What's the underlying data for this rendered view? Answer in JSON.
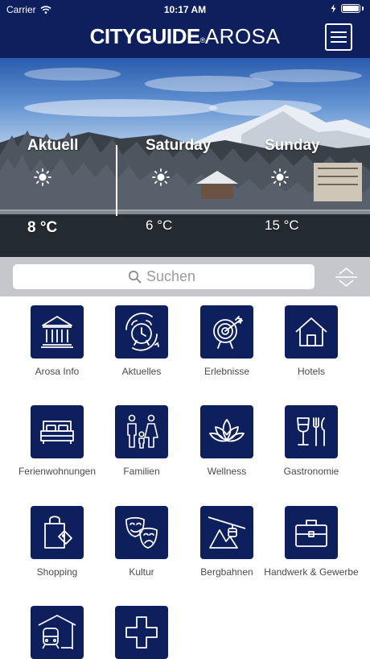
{
  "status_bar": {
    "carrier": "Carrier",
    "time": "10:17 AM"
  },
  "header": {
    "brand": "CITYGUIDE",
    "registered": "®",
    "town": "AROSA",
    "background_color": "#0d1f5c"
  },
  "weather": [
    {
      "label": "Aktuell",
      "temp": "8 °C",
      "icon": "sun-icon"
    },
    {
      "label": "Saturday",
      "temp": "6 °C",
      "icon": "sun-icon"
    },
    {
      "label": "Sunday",
      "temp": "15 °C",
      "icon": "sun-icon"
    }
  ],
  "search": {
    "placeholder": "Suchen"
  },
  "categories": [
    {
      "label": "Arosa Info",
      "icon": "museum-icon"
    },
    {
      "label": "Aktuelles",
      "icon": "alarm-clock-icon"
    },
    {
      "label": "Erlebnisse",
      "icon": "target-icon"
    },
    {
      "label": "Hotels",
      "icon": "house-icon"
    },
    {
      "label": "Ferienwohnungen",
      "icon": "bed-icon"
    },
    {
      "label": "Familien",
      "icon": "family-icon"
    },
    {
      "label": "Wellness",
      "icon": "lotus-icon"
    },
    {
      "label": "Gastronomie",
      "icon": "wine-glass-cutlery-icon"
    },
    {
      "label": "Shopping",
      "icon": "shopping-bag-icon"
    },
    {
      "label": "Kultur",
      "icon": "theater-masks-icon"
    },
    {
      "label": "Bergbahnen",
      "icon": "cable-car-icon"
    },
    {
      "label": "Handwerk & Gewerbe",
      "icon": "briefcase-icon"
    },
    {
      "label": "",
      "icon": "train-station-icon"
    },
    {
      "label": "",
      "icon": "medical-cross-icon"
    }
  ],
  "colors": {
    "accent": "#0d1f5c",
    "search_bar": "#c6c7cc"
  }
}
